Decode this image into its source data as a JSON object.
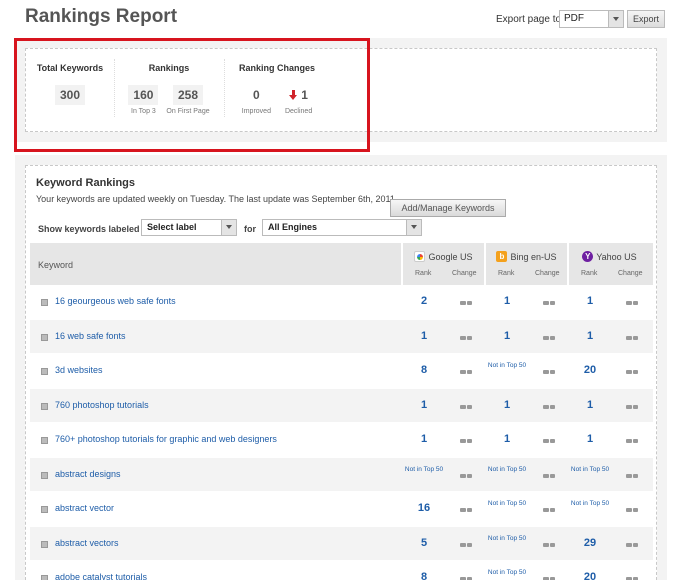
{
  "header": {
    "title": "Rankings Report",
    "export_label": "Export page to",
    "export_format": "PDF",
    "export_button": "Export"
  },
  "summary": {
    "total_keywords": {
      "title": "Total Keywords",
      "value": "300"
    },
    "rankings": {
      "title": "Rankings",
      "top3_value": "160",
      "top3_label": "In Top 3",
      "first_page_value": "258",
      "first_page_label": "On First Page"
    },
    "ranking_changes": {
      "title": "Ranking Changes",
      "improved_value": "0",
      "improved_label": "Improved",
      "declined_value": "1",
      "declined_label": "Declined"
    }
  },
  "keyword_rankings": {
    "title": "Keyword Rankings",
    "description": "Your keywords are updated weekly on Tuesday. The last update was September 6th, 2011.",
    "add_manage_button": "Add/Manage Keywords",
    "show_label": "Show keywords labeled",
    "label_select_value": "Select label",
    "for_label": "for",
    "engine_select_value": "All Engines",
    "columns": {
      "keyword": "Keyword",
      "rank": "Rank",
      "change": "Change"
    },
    "engines": [
      {
        "name": "Google US",
        "icon": "google-icon"
      },
      {
        "name": "Bing en-US",
        "icon": "bing-icon"
      },
      {
        "name": "Yahoo US",
        "icon": "yahoo-icon"
      }
    ],
    "rows": [
      {
        "keyword": "16 geourgeous web safe fonts",
        "ranks": [
          "2",
          "1",
          "1"
        ]
      },
      {
        "keyword": "16 web safe fonts",
        "ranks": [
          "1",
          "1",
          "1"
        ]
      },
      {
        "keyword": "3d websites",
        "ranks": [
          "8",
          "Not in Top 50",
          "20"
        ]
      },
      {
        "keyword": "760 photoshop tutorials",
        "ranks": [
          "1",
          "1",
          "1"
        ]
      },
      {
        "keyword": "760+ photoshop tutorials for graphic and web designers",
        "ranks": [
          "1",
          "1",
          "1"
        ]
      },
      {
        "keyword": "abstract designs",
        "ranks": [
          "Not in Top 50",
          "Not in Top 50",
          "Not in Top 50"
        ]
      },
      {
        "keyword": "abstract vector",
        "ranks": [
          "16",
          "Not in Top 50",
          "Not in Top 50"
        ]
      },
      {
        "keyword": "abstract vectors",
        "ranks": [
          "5",
          "Not in Top 50",
          "29"
        ]
      },
      {
        "keyword": "adobe catalyst tutorials",
        "ranks": [
          "8",
          "Not in Top 50",
          "20"
        ]
      }
    ]
  }
}
